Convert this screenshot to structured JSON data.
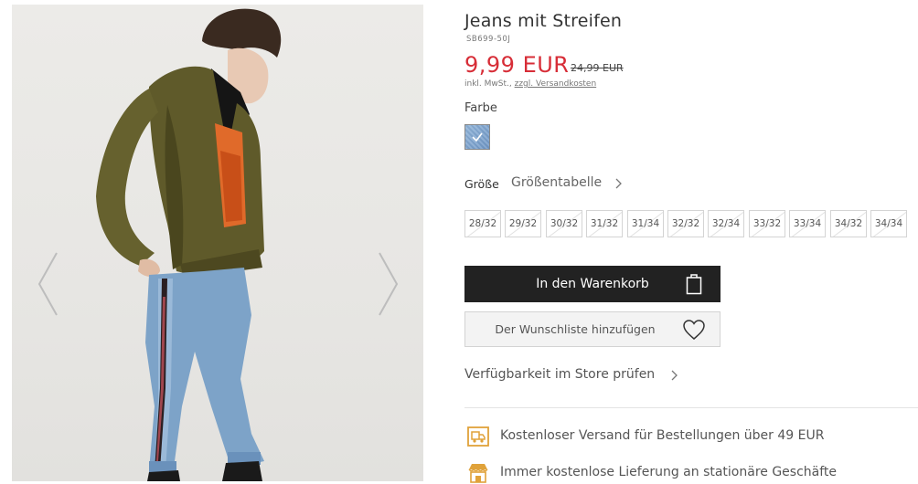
{
  "product": {
    "title": "Jeans mit Streifen",
    "sku": "SB699-50J",
    "price": "9,99 EUR",
    "old_price": "24,99 EUR",
    "tax_note": "inkl. MwSt.,",
    "shipping_link": "zzgl. Versandkosten"
  },
  "color": {
    "label": "Farbe",
    "swatch_color": "#7fa4cf"
  },
  "size": {
    "label": "Größe",
    "chart_link": "Größentabelle",
    "options": [
      "28/32",
      "29/32",
      "30/32",
      "31/32",
      "31/34",
      "32/32",
      "32/34",
      "33/32",
      "33/34",
      "34/32",
      "34/34"
    ]
  },
  "actions": {
    "cart": "In den Warenkorb",
    "wishlist": "Der Wunschliste hinzufügen",
    "store_availability": "Verfügbarkeit im Store prüfen"
  },
  "benefits": [
    {
      "icon": "delivery-truck-icon",
      "text": "Kostenloser Versand für Bestellungen über 49 EUR"
    },
    {
      "icon": "store-icon",
      "text": "Immer kostenlose Lieferung an stationäre Geschäfte"
    }
  ],
  "colors": {
    "accent_price": "#d72d37",
    "cart_button": "#222222",
    "benefit_icon": "#e0a23a"
  }
}
